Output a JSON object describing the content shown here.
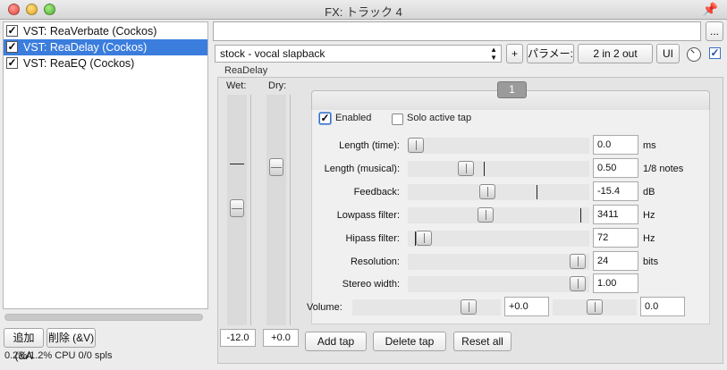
{
  "window": {
    "title": "FX: トラック 4"
  },
  "fx_list": [
    {
      "label": "VST: ReaVerbate (Cockos)",
      "enabled": true,
      "selected": false
    },
    {
      "label": "VST: ReaDelay (Cockos)",
      "enabled": true,
      "selected": true
    },
    {
      "label": "VST: ReaEQ (Cockos)",
      "enabled": true,
      "selected": false
    }
  ],
  "bottom_left": {
    "add_label": "追加 (&A",
    "delete_label": "削除 (&V)",
    "status": "0.2%/1.2% CPU 0/0 spls"
  },
  "toolbar": {
    "top_input_value": "",
    "browse_label": "...",
    "preset": "stock - vocal slapback",
    "plus_label": "+",
    "param_label": "パラメー:",
    "io_label": "2 in 2 out",
    "ui_label": "UI",
    "bypass_checked": true
  },
  "plugin": {
    "name": "ReaDelay"
  },
  "mix": {
    "wet_label": "Wet:",
    "dry_label": "Dry:",
    "wet_value": "-12.0",
    "dry_value": "+0.0",
    "wet_level": 0.51,
    "dry_level": 0.7
  },
  "tap": {
    "tab_label": "1",
    "enabled_label": "Enabled",
    "enabled": true,
    "solo_label": "Solo active tap",
    "solo": false
  },
  "params": [
    {
      "label": "Length (time):",
      "value": "0.0",
      "unit": "ms",
      "position": 0.0,
      "marker": null
    },
    {
      "label": "Length (musical):",
      "value": "0.50",
      "unit": "1/8 notes",
      "position": 0.3,
      "marker": 0.42
    },
    {
      "label": "Feedback:",
      "value": "-15.4",
      "unit": "dB",
      "position": 0.43,
      "marker": 0.71
    },
    {
      "label": "Lowpass filter:",
      "value": "3411",
      "unit": "Hz",
      "position": 0.42,
      "marker": 0.95
    },
    {
      "label": "Hipass filter:",
      "value": "72",
      "unit": "Hz",
      "position": 0.05,
      "marker": 0.04
    },
    {
      "label": "Resolution:",
      "value": "24",
      "unit": "bits",
      "position": 0.98,
      "marker": null
    },
    {
      "label": "Stereo width:",
      "value": "1.00",
      "unit": "",
      "position": 0.98,
      "marker": null
    }
  ],
  "volume": {
    "label": "Volume:",
    "value": "+0.0",
    "pan_value": "0.0",
    "position": 0.82,
    "pan_position": 0.5
  },
  "actions": {
    "add_tap": "Add tap",
    "delete_tap": "Delete tap",
    "reset_all": "Reset all"
  }
}
